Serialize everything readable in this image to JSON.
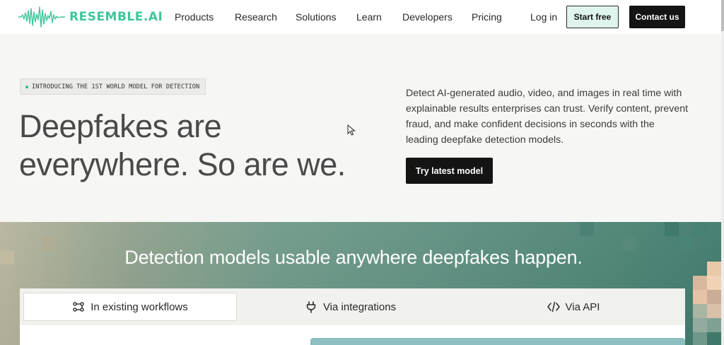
{
  "brand": {
    "name": "RESEMBLE.AI",
    "color": "#3fc59c"
  },
  "nav": {
    "items": [
      {
        "label": "Products"
      },
      {
        "label": "Research"
      },
      {
        "label": "Solutions"
      },
      {
        "label": "Learn"
      },
      {
        "label": "Developers"
      },
      {
        "label": "Pricing"
      }
    ],
    "login_label": "Log in",
    "start_label": "Start free",
    "contact_label": "Contact us"
  },
  "hero": {
    "badge": "INTRODUCING THE 1ST WORLD MODEL FOR DETECTION",
    "title_line1": "Deepfakes are",
    "title_line2": "everywhere. So are we.",
    "description": "Detect AI-generated audio, video, and images in real time with explainable results enterprises can trust. Verify content, prevent fraud, and make confident decisions in seconds with the leading deepfake detection models.",
    "cta_label": "Try latest model"
  },
  "section": {
    "title": "Detection models usable anywhere deepfakes happen.",
    "tabs": [
      {
        "label": "In existing workflows",
        "icon": "workflow-icon",
        "active": true
      },
      {
        "label": "Via integrations",
        "icon": "plug-icon",
        "active": false
      },
      {
        "label": "Via API",
        "icon": "code-icon",
        "active": false
      }
    ]
  },
  "colors": {
    "dark_button": "#141414",
    "start_button_bg": "#dff4ec",
    "accent": "#3fc59c"
  }
}
